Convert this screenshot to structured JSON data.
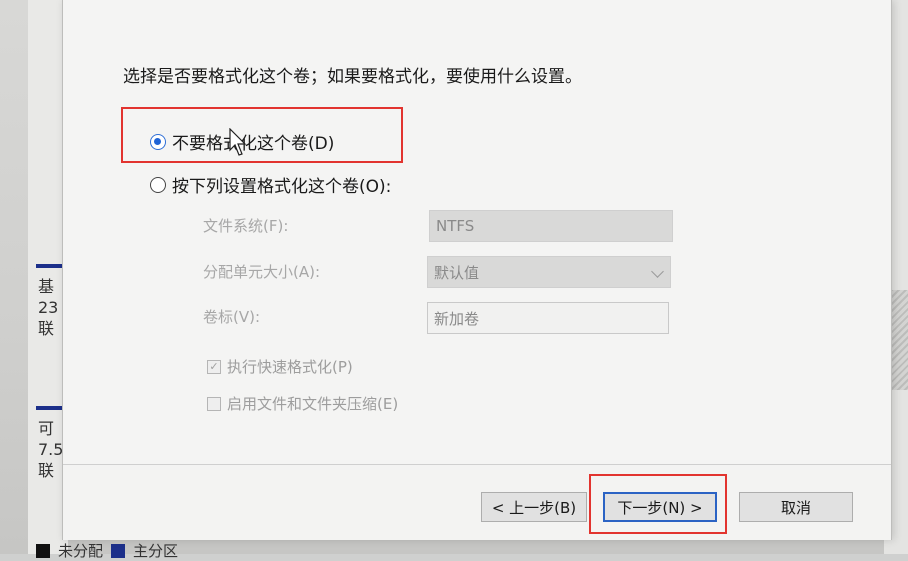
{
  "dialog": {
    "prompt": "选择是否要格式化这个卷；如果要格式化，要使用什么设置。",
    "option_no_format": "不要格式化这个卷(D)",
    "option_format": "按下列设置格式化这个卷(O):",
    "file_system_label": "文件系统(F):",
    "file_system_value": "NTFS",
    "alloc_unit_label": "分配单元大小(A):",
    "alloc_unit_value": "默认值",
    "volume_label_label": "卷标(V):",
    "volume_label_value": "新加卷",
    "quick_format_label": "执行快速格式化(P)",
    "compression_label": "启用文件和文件夹压缩(E)",
    "selected_option": "no_format"
  },
  "buttons": {
    "back": "< 上一步(B)",
    "next": "下一步(N) >",
    "cancel": "取消"
  },
  "background": {
    "disk1_text": "基\n23\n联",
    "disk2_text": "可\n7.5\n联",
    "legend_unallocated": "未分配",
    "legend_primary": "主分区"
  },
  "colors": {
    "highlight": "#e2342f",
    "radio_selected": "#1e63d6",
    "legend_unallocated": "#111111",
    "legend_primary": "#1c2f8a"
  }
}
